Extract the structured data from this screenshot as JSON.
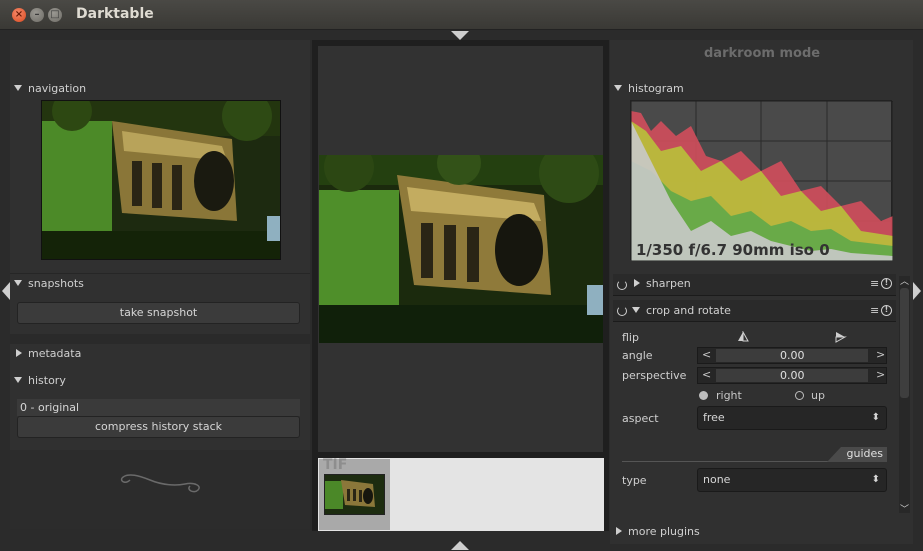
{
  "window": {
    "title": "Darktable"
  },
  "right_header": {
    "mode_label": "darkroom mode"
  },
  "left": {
    "navigation": {
      "label": "navigation"
    },
    "snapshots": {
      "label": "snapshots",
      "take_snapshot": "take snapshot"
    },
    "metadata": {
      "label": "metadata"
    },
    "history": {
      "label": "history",
      "items": [
        "0 - original"
      ],
      "compress": "compress history stack"
    }
  },
  "right": {
    "histogram": {
      "label": "histogram",
      "exif": "1/350 f/6.7 90mm iso 0"
    },
    "sharpen": {
      "label": "sharpen"
    },
    "crop": {
      "label": "crop and rotate",
      "flip_label": "flip",
      "angle_label": "angle",
      "angle_value": "0.00",
      "perspective_label": "perspective",
      "perspective_value": "0.00",
      "radio_right": "right",
      "radio_up": "up",
      "aspect_label": "aspect",
      "aspect_value": "free",
      "guides_label": "guides",
      "type_label": "type",
      "type_value": "none"
    },
    "more_plugins": "more plugins"
  },
  "filmstrip": {
    "format_badge": "TIF"
  },
  "colors": {
    "background": "#2b2b2b",
    "panel": "#303030",
    "accent": "#e25a2b"
  }
}
